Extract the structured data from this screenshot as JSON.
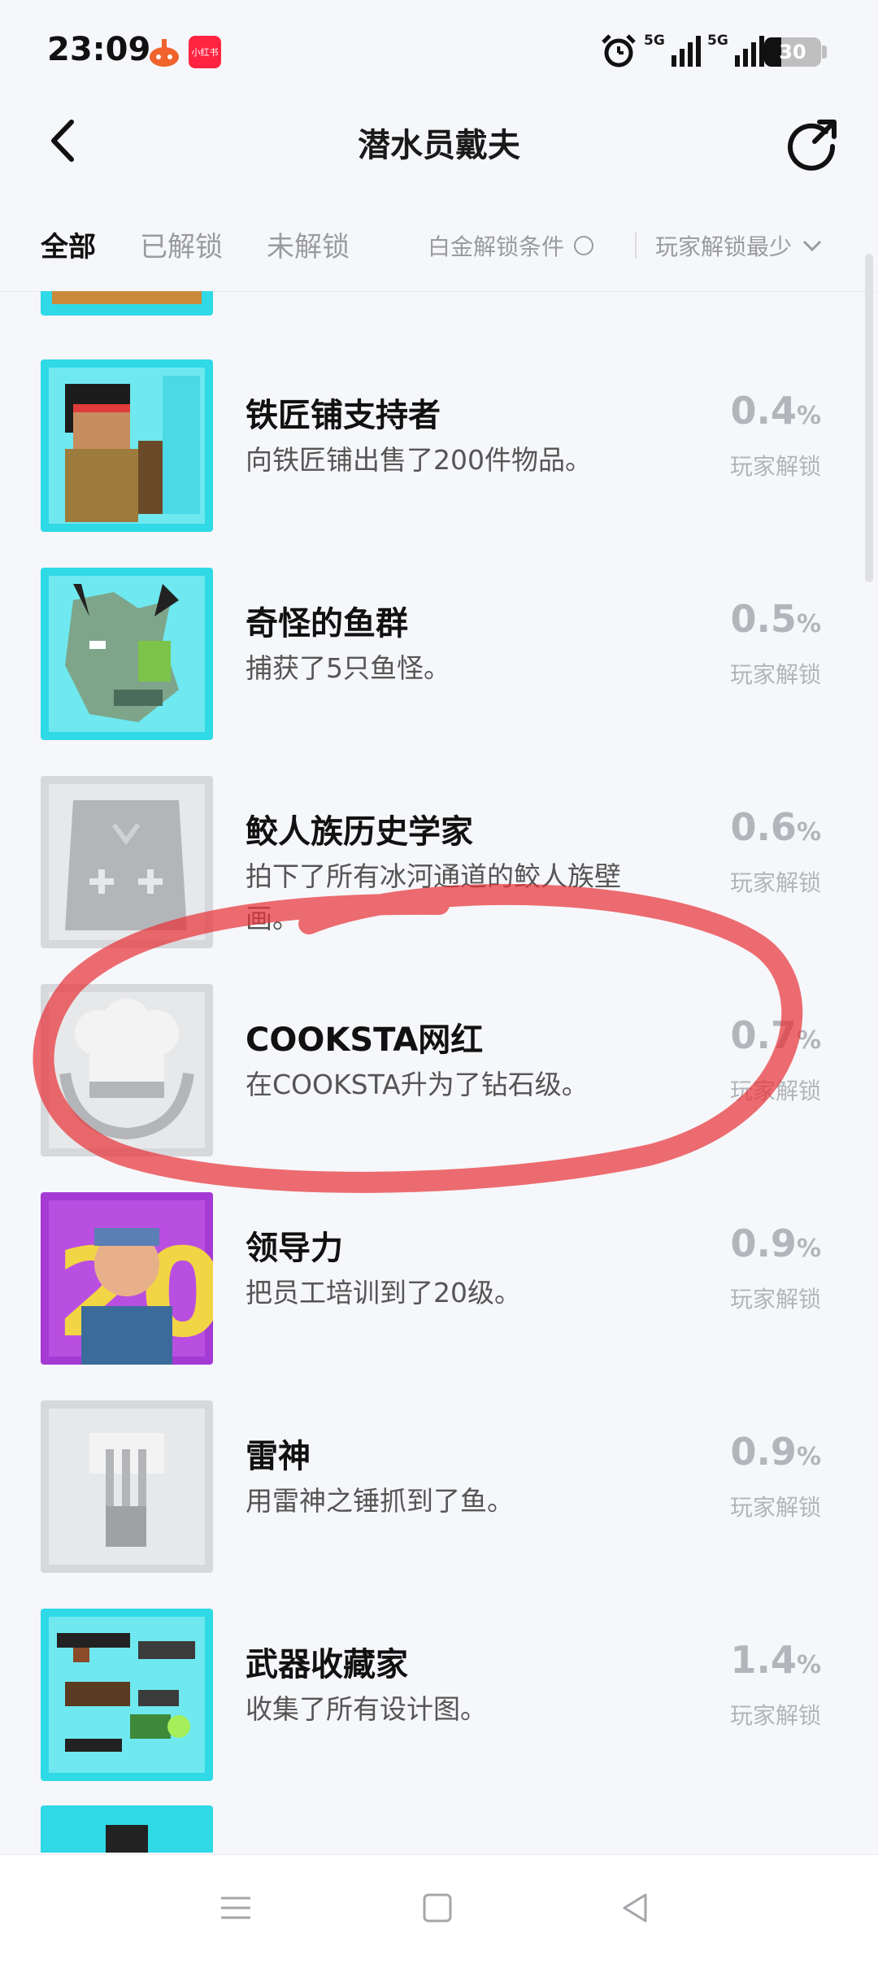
{
  "status_bar": {
    "time": "23:09",
    "app_icon_1": "game-app-icon",
    "app_icon_2": "小红书",
    "alarm_icon": "alarm-clock-icon",
    "signal_1": "5G",
    "signal_2": "5G",
    "battery": "30",
    "battery_level": 0.3
  },
  "header": {
    "back_icon": "back-arrow-icon",
    "title": "潜水员戴夫",
    "share_icon": "share-icon"
  },
  "tabs": [
    {
      "label": "全部",
      "active": true
    },
    {
      "label": "已解锁",
      "active": false
    },
    {
      "label": "未解锁",
      "active": false
    }
  ],
  "filters": {
    "platinum_label": "白金解锁条件",
    "sort_label": "玩家解锁最少"
  },
  "achievements": [
    {
      "name": "铁匠铺支持者",
      "desc": "向铁匠铺出售了200件物品。",
      "percent": "0.4",
      "percent_sign": "%",
      "unlock_label": "玩家解锁",
      "unlocked": true,
      "icon": "blacksmith-character-icon"
    },
    {
      "name": "奇怪的鱼群",
      "desc": "捕获了5只鱼怪。",
      "percent": "0.5",
      "percent_sign": "%",
      "unlock_label": "玩家解锁",
      "unlocked": true,
      "icon": "fish-monster-icon"
    },
    {
      "name": "鲛人族历史学家",
      "desc": "拍下了所有冰河通道的鲛人族壁画。",
      "percent": "0.6",
      "percent_sign": "%",
      "unlock_label": "玩家解锁",
      "unlocked": false,
      "icon": "mural-stone-icon"
    },
    {
      "name": "COOKSTA网红",
      "desc": "在COOKSTA升为了钻石级。",
      "percent": "0.7",
      "percent_sign": "%",
      "unlock_label": "玩家解锁",
      "unlocked": false,
      "icon": "chef-hat-icon"
    },
    {
      "name": "领导力",
      "desc": "把员工培训到了20级。",
      "percent": "0.9",
      "percent_sign": "%",
      "unlock_label": "玩家解锁",
      "unlocked": true,
      "icon": "staff-level-20-icon"
    },
    {
      "name": "雷神",
      "desc": "用雷神之锤抓到了鱼。",
      "percent": "0.9",
      "percent_sign": "%",
      "unlock_label": "玩家解锁",
      "unlocked": false,
      "icon": "thor-hammer-icon"
    },
    {
      "name": "武器收藏家",
      "desc": "收集了所有设计图。",
      "percent": "1.4",
      "percent_sign": "%",
      "unlock_label": "玩家解锁",
      "unlocked": true,
      "icon": "weapons-icon"
    }
  ],
  "bottom_nav": {
    "menu_icon": "menu-icon",
    "home_icon": "home-square-icon",
    "back_icon": "back-triangle-icon"
  },
  "colors": {
    "annotation_red": "#e8343a",
    "unlocked_cyan": "#2fd9e6",
    "purple": "#a53ad4",
    "locked_gray": "#d7d8db"
  }
}
